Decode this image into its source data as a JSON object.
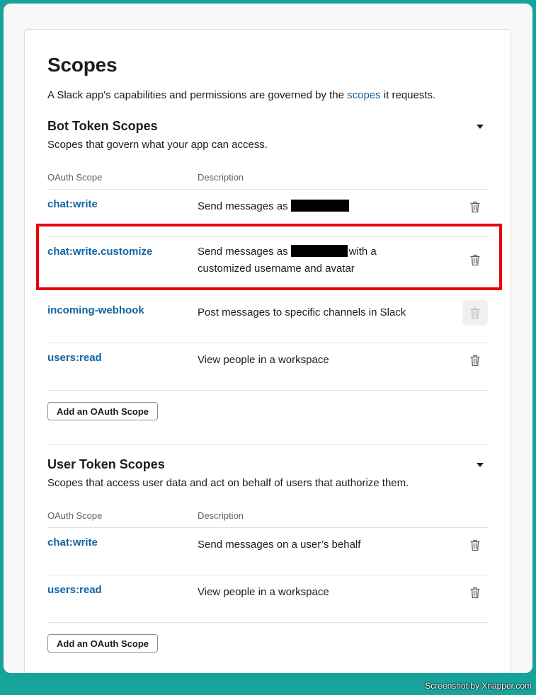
{
  "title": "Scopes",
  "intro": {
    "before": "A Slack app's capabilities and permissions are governed by the ",
    "link": "scopes",
    "after": " it requests."
  },
  "bot_section": {
    "title": "Bot Token Scopes",
    "subtitle": "Scopes that govern what your app can access.",
    "col_scope": "OAuth Scope",
    "col_desc": "Description",
    "rows": [
      {
        "scope": "chat:write",
        "desc_before": "Send messages as",
        "desc_after": ""
      },
      {
        "scope": "chat:write.customize",
        "desc_before": "Send messages as",
        "desc_after": "with a",
        "desc_line2": "customized username and avatar"
      },
      {
        "scope": "incoming-webhook",
        "desc": "Post messages to specific channels in Slack"
      },
      {
        "scope": "users:read",
        "desc": "View people in a workspace"
      }
    ],
    "add_button": "Add an OAuth Scope"
  },
  "user_section": {
    "title": "User Token Scopes",
    "subtitle": "Scopes that access user data and act on behalf of users that authorize them.",
    "col_scope": "OAuth Scope",
    "col_desc": "Description",
    "rows": [
      {
        "scope": "chat:write",
        "desc": "Send messages on a user’s behalf"
      },
      {
        "scope": "users:read",
        "desc": "View people in a workspace"
      }
    ],
    "add_button": "Add an OAuth Scope"
  },
  "footer": "Screenshot by Xnapper.com",
  "colors": {
    "accent": "#1264a3",
    "highlight": "#e8000e",
    "background": "#17a39c"
  }
}
